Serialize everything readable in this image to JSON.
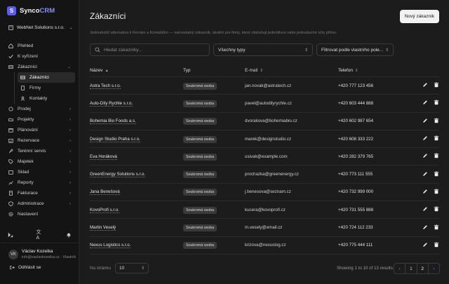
{
  "brand": {
    "name_a": "Synco",
    "name_b": "CRM",
    "logo_letter": "S"
  },
  "org": {
    "name": "WebNet Solutions s.r.o."
  },
  "nav": {
    "prehled": "Přehled",
    "vyrizeni": "K vyřízení",
    "zakaznici": "Zákazníci",
    "sub": {
      "zakaznici": "Zákazníci",
      "firmy": "Firmy",
      "kontakty": "Kontakty"
    },
    "prodej": "Prodej",
    "projekty": "Projekty",
    "planovani": "Plánování",
    "rezervace": "Rezervace",
    "terenni": "Terénní servis",
    "majetek": "Majetek",
    "sklad": "Sklad",
    "reporty": "Reporty",
    "fakturace": "Fakturace",
    "administrace": "Administrace",
    "nastaveni": "Nastavení"
  },
  "user": {
    "initials": "VK",
    "name": "Václav Kozelka",
    "email": "info@vaclavkozelka.cz · Vlastník",
    "logout": "Odhlásit se"
  },
  "page": {
    "title": "Zákazníci",
    "new_button": "Nový zákazník",
    "description": "Jednodušší alternativa k Firmám a Kontaktům — samostatný zákazník, ideální pro firmy, které obsluhují jednotlivce nebo jednoduché účty přímo."
  },
  "filters": {
    "search_placeholder": "Hledat zákazníky...",
    "type": "Všechny typy",
    "owner": "Filtrovat podle vlastního pole..."
  },
  "table": {
    "headers": {
      "name": "Název",
      "type": "Typ",
      "email": "E-mail",
      "phone": "Telefon"
    },
    "rows": [
      {
        "name": "Astra Tech s.r.o.",
        "type": "Soukromá osoba",
        "email": "jan.novak@astratech.cz",
        "phone": "+420 777 123 456"
      },
      {
        "name": "Auto-Díly Rychle s.r.o.",
        "type": "Soukromá osoba",
        "email": "pavel@autodilyrychle.cz",
        "phone": "+420 603 444 888"
      },
      {
        "name": "Bohemia Bio Foods a.s.",
        "type": "Soukromá osoba",
        "email": "dvorakova@bohemiabio.cz",
        "phone": "+420 602 987 654"
      },
      {
        "name": "Design Studio Praha s.r.o.",
        "type": "Soukromá osoba",
        "email": "marek@designstudio.cz",
        "phone": "+420 608 333 222"
      },
      {
        "name": "Eva Horáková",
        "type": "Soukromá osoba",
        "email": "usivak@example.com",
        "phone": "+420 282 379 765"
      },
      {
        "name": "GreenEnergy Solutions s.r.o.",
        "type": "Soukromá osoba",
        "email": "prochazka@greenenergy.cz",
        "phone": "+420 773 111 555"
      },
      {
        "name": "Jana Benešová",
        "type": "Soukromá osoba",
        "email": "j.benesova@seznam.cz",
        "phone": "+420 732 999 000"
      },
      {
        "name": "KovoProfi s.r.o.",
        "type": "Soukromá osoba",
        "email": "kucera@kovoprofi.cz",
        "phone": "+420 731 555 888"
      },
      {
        "name": "Martin Veselý",
        "type": "Soukromá osoba",
        "email": "m.vesely@email.cz",
        "phone": "+420 724 112 233"
      },
      {
        "name": "Nexus Logistics s.r.o.",
        "type": "Soukromá osoba",
        "email": "krizova@nexuslog.cz",
        "phone": "+420 775 444 111"
      }
    ]
  },
  "pagination": {
    "per_page_label": "Na stránku",
    "per_page": "10",
    "showing": "Showing 1 to 10 of 13 results",
    "pages": [
      "1",
      "2"
    ],
    "current_page": "2"
  }
}
